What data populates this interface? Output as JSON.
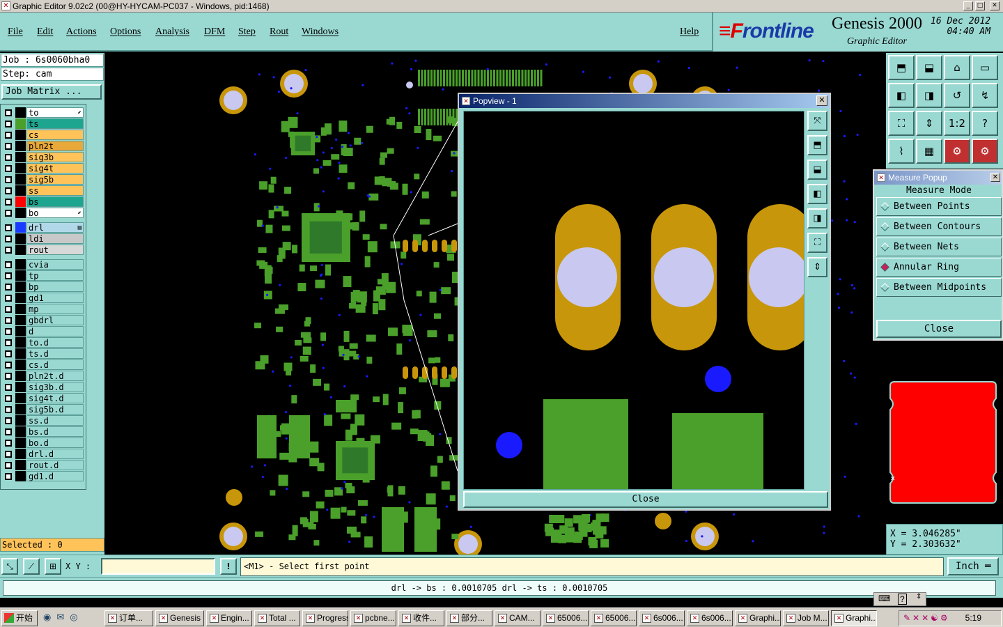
{
  "window": {
    "title": "Graphic Editor 9.02c2 (00@HY-HYCAM-PC037 - Windows, pid:1468)",
    "min": "_",
    "max": "□",
    "close": "✕"
  },
  "menu": [
    "File",
    "Edit",
    "Actions",
    "Options",
    "Analysis",
    "DFM",
    "Step",
    "Rout",
    "Windows"
  ],
  "help": "Help",
  "brand": {
    "logo_pre": "≡F",
    "logo_post": "rontline",
    "product": "Genesis 2000",
    "subtitle": "Graphic Editor",
    "date": "16 Dec 2012",
    "time": "04:40 AM"
  },
  "job": {
    "label": "Job : 6s0060bha0",
    "step": "Step: cam",
    "matrix_btn": "Job Matrix ..."
  },
  "layers_board": [
    {
      "name": "to",
      "color": "#ffffff",
      "swatch": "#000000",
      "marker": "⬋"
    },
    {
      "name": "ts",
      "color": "#1ea58f",
      "swatch": "#4aa02a"
    },
    {
      "name": "cs",
      "color": "#ffc35a",
      "swatch": "#000000"
    },
    {
      "name": "pln2t",
      "color": "#e9a83a",
      "swatch": "#000000"
    },
    {
      "name": "sig3b",
      "color": "#ffc35a",
      "swatch": "#000000"
    },
    {
      "name": "sig4t",
      "color": "#ffc35a",
      "swatch": "#000000"
    },
    {
      "name": "sig5b",
      "color": "#ffc35a",
      "swatch": "#000000"
    },
    {
      "name": "ss",
      "color": "#ffc35a",
      "swatch": "#000000"
    },
    {
      "name": "bs",
      "color": "#1ea58f",
      "swatch": "#ff0000"
    },
    {
      "name": "bo",
      "color": "#ffffff",
      "swatch": "#000000",
      "marker": "⬋"
    }
  ],
  "layers_drill": [
    {
      "name": "drl",
      "color": "#b0d8e8",
      "swatch": "#1a3aff",
      "marker": "▤"
    },
    {
      "name": "ldi",
      "color": "#c8c8c8",
      "swatch": "#000000"
    },
    {
      "name": "rout",
      "color": "#d8d8d8",
      "swatch": "#000000"
    }
  ],
  "layers_misc": [
    "cvia",
    "tp",
    "bp",
    "gd1",
    "mp",
    "gbdrl",
    "d",
    "to.d",
    "ts.d",
    "cs.d",
    "pln2t.d",
    "sig3b.d",
    "sig4t.d",
    "sig5b.d",
    "ss.d",
    "bs.d",
    "bo.d",
    "drl.d",
    "rout.d",
    "gd1.d"
  ],
  "selected": "Selected : 0",
  "popview": {
    "title": "Popview - 1",
    "close": "Close",
    "tools": [
      "⤧",
      "⬒",
      "⬓",
      "◧",
      "◨",
      "⛶",
      "⇕"
    ]
  },
  "toolgrid": [
    "⬒",
    "⬓",
    "⌂",
    "▭",
    "◧",
    "◨",
    "↺",
    "↯",
    "⛶",
    "⇕",
    "1:2",
    "?",
    "⌇",
    "▦",
    "⚙",
    "⚙"
  ],
  "measure": {
    "title": "Measure Popup",
    "heading": "Measure Mode",
    "options": [
      "Between Points",
      "Between Contours",
      "Between Nets",
      "Annular Ring",
      "Between Midpoints"
    ],
    "selected": "Annular Ring",
    "close": "Close"
  },
  "coords": {
    "x": "X = 3.046285\"",
    "y": "Y = 2.303632\""
  },
  "cmd": {
    "xy_label": "X Y :",
    "xy_value": "",
    "prompt": "<M1> - Select first point",
    "unit": "Inch ═"
  },
  "status": "drl -> bs : 0.0010705    drl -> ts : 0.0010705",
  "taskbar": {
    "start": "开始",
    "items": [
      "订单...",
      "Genesis",
      "Engin...",
      "Total ...",
      "Progress",
      "pcbne...",
      "收件...",
      "部分...",
      "CAM...",
      "65006...",
      "65006...",
      "6s006...",
      "6s006...",
      "Graphi...",
      "Job M...",
      "Graphi..."
    ],
    "active": 15,
    "clock": "5:19"
  },
  "colors": {
    "panel": "#9ad9d2",
    "pad_green": "#4aa02a",
    "copper": "#c8960a",
    "drill": "#c8c8f0",
    "via": "#1a1aff"
  }
}
